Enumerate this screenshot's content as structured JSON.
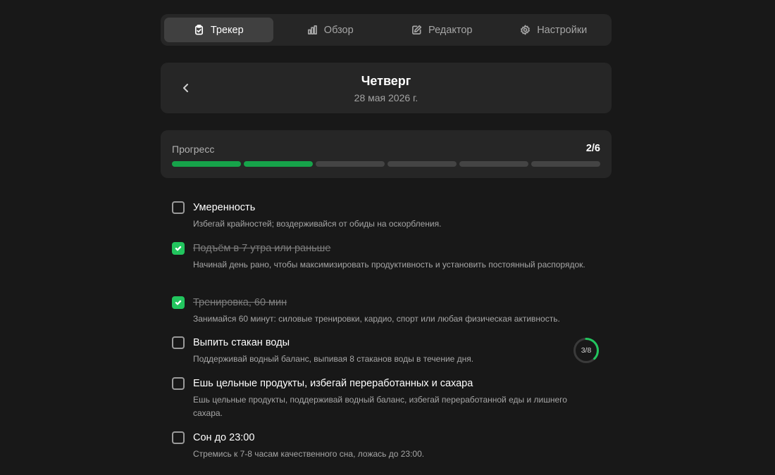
{
  "tabs": [
    {
      "label": "Трекер",
      "icon": "clipboard-check-icon",
      "active": true
    },
    {
      "label": "Обзор",
      "icon": "bar-chart-icon",
      "active": false
    },
    {
      "label": "Редактор",
      "icon": "pencil-square-icon",
      "active": false
    },
    {
      "label": "Настройки",
      "icon": "gear-icon",
      "active": false
    }
  ],
  "day": {
    "title": "Четверг",
    "date": "28 мая 2026 г.",
    "back_icon": "chevron-left-icon"
  },
  "progress": {
    "label": "Прогресс",
    "count": "2/6",
    "completed": 2,
    "total": 6,
    "accent": "#16a34a"
  },
  "habits": [
    {
      "title": "Умеренность",
      "description": "Избегай крайностей; воздерживайся от обиды на оскорбления.",
      "checked": false
    },
    {
      "title": "Подъём в 7 утра или раньше",
      "description": "Начинай день рано, чтобы максимизировать продуктивность и установить постоянный распорядок.",
      "checked": true
    },
    {
      "title": "Тренировка, 60 мин",
      "description": "Занимайся 60 минут: силовые тренировки, кардио, спорт или любая физическая активность.",
      "checked": true
    },
    {
      "title": "Выпить стакан воды",
      "description": "Поддерживай водный баланс, выпивая 8 стаканов воды в течение дня.",
      "checked": false,
      "counter": {
        "text": "3/8",
        "current": 3,
        "target": 8
      }
    },
    {
      "title": "Ешь цельные продукты, избегай переработанных и сахара",
      "description": "Ешь цельные продукты, поддерживай водный баланс, избегай переработанной еды и лишнего сахара.",
      "checked": false
    },
    {
      "title": "Сон до 23:00",
      "description": "Стремись к 7-8 часам качественного сна, ложась до 23:00.",
      "checked": false
    }
  ],
  "colors": {
    "background": "#181818",
    "card": "#262626",
    "check": "#22c55e"
  }
}
